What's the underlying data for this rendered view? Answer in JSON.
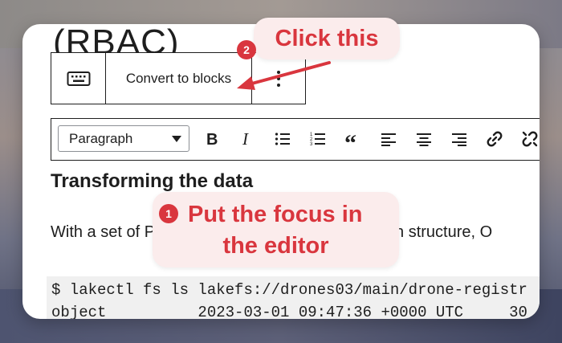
{
  "page": {
    "heading_partial": "(RBAC)",
    "section_heading": "Transforming the data",
    "paragraph_visible": "With a set of Parqu",
    "paragraph_right": "unknown structure, O"
  },
  "block_toolbar": {
    "keyboard_icon": "keyboard-icon",
    "convert_label": "Convert to blocks",
    "more_icon": "vertical-ellipsis-icon"
  },
  "format_toolbar": {
    "block_type": "Paragraph",
    "icons": [
      "bold-icon",
      "italic-icon",
      "unordered-list-icon",
      "ordered-list-icon",
      "quote-icon",
      "align-left-icon",
      "align-center-icon",
      "align-right-icon",
      "link-icon",
      "unlink-icon"
    ]
  },
  "code": {
    "line1": "$ lakectl fs ls lakefs://drones03/main/drone-registr",
    "line2": "object          2023-03-01 09:47:36 +0000 UTC     30"
  },
  "callouts": {
    "step1": {
      "number": "1",
      "line1": "Put the focus in",
      "line2": "the editor"
    },
    "step2": {
      "number": "2",
      "text": "Click this"
    }
  },
  "colors": {
    "accent": "#d9363e",
    "callout_bg": "#fbecec"
  }
}
